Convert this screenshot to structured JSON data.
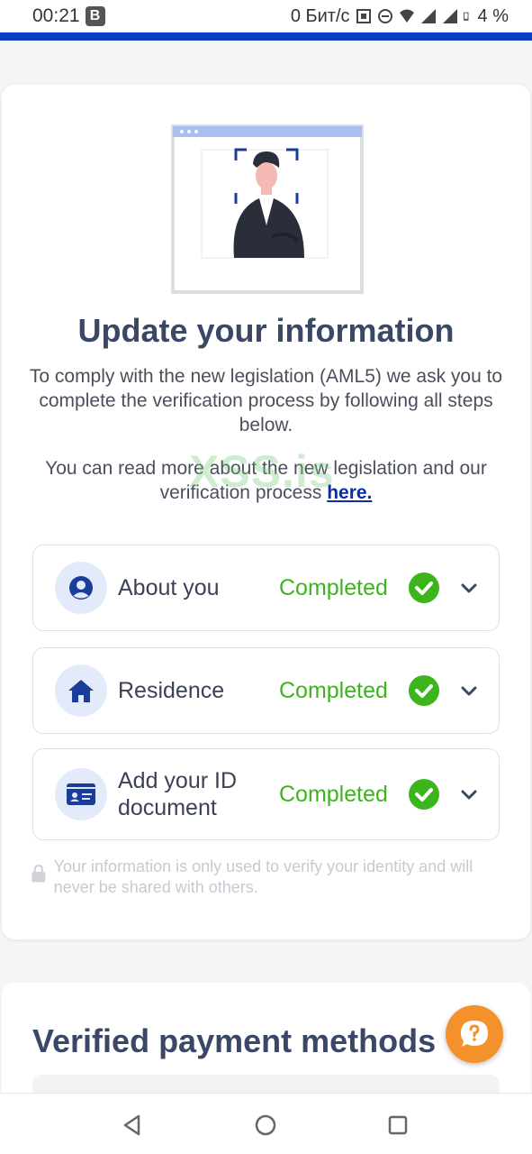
{
  "status_bar": {
    "time": "00:21",
    "badge": "B",
    "network_speed": "0 Бит/с",
    "battery": "4 %"
  },
  "main": {
    "heading": "Update your information",
    "intro": "To comply with the new legislation (AML5) we ask you to complete the verification process by following all steps below.",
    "more_text": "You can read more about the new legislation and our verification process ",
    "more_link": "here.",
    "steps": [
      {
        "label": "About you",
        "status": "Completed",
        "icon": "user-icon"
      },
      {
        "label": "Residence",
        "status": "Completed",
        "icon": "home-icon"
      },
      {
        "label": "Add your ID document",
        "status": "Completed",
        "icon": "id-card-icon"
      }
    ],
    "privacy": "Your information is only used to verify your identity and will never be shared with others."
  },
  "payment": {
    "heading": "Verified payment methods"
  },
  "watermark": "XSS.is",
  "colors": {
    "accent": "#0a3fc4",
    "heading": "#3b4766",
    "completed": "#3cb51c",
    "link": "#0b2ea8",
    "help": "#f5912b"
  }
}
